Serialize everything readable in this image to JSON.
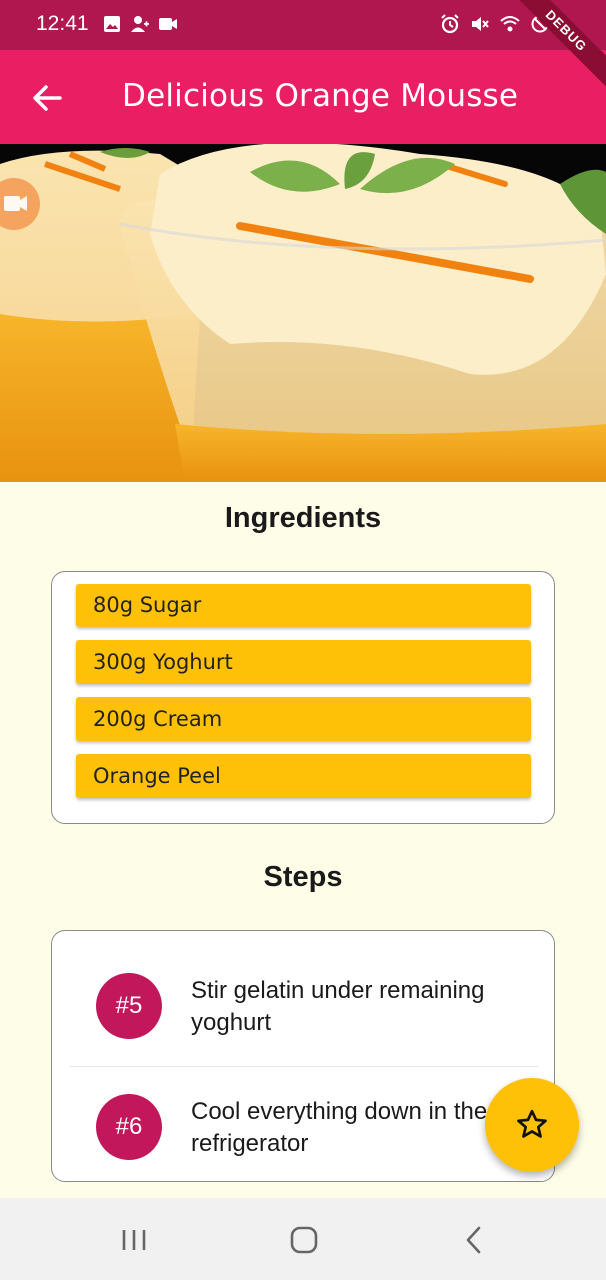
{
  "status_bar": {
    "time": "12:41",
    "left_icons": [
      "image-icon",
      "person-add-icon",
      "video-icon"
    ],
    "right_icons": [
      "alarm-icon",
      "mute-icon",
      "wifi-icon",
      "block-icon",
      "battery-icon"
    ],
    "debug_label": "DEBUG",
    "color": "#b0174f"
  },
  "app_bar": {
    "title": "Delicious Orange Mousse",
    "back_icon": "arrow-back-icon",
    "color": "#e91e63"
  },
  "hero": {
    "video_icon": "videocam-icon"
  },
  "ingredients": {
    "title": "Ingredients",
    "items": [
      "80g Sugar",
      "300g Yoghurt",
      "200g Cream",
      "Orange Peel"
    ],
    "item_color": "#ffc107"
  },
  "steps": {
    "title": "Steps",
    "items": [
      {
        "number": "#5",
        "text": "Stir gelatin under remaining yoghurt"
      },
      {
        "number": "#6",
        "text": "Cool everything down in the refrigerator"
      }
    ],
    "badge_color": "#c2185b"
  },
  "fab": {
    "icon": "star-outline-icon",
    "color": "#ffc107"
  },
  "nav_bar": {
    "icons": [
      "recent-apps-icon",
      "home-icon",
      "back-icon"
    ]
  }
}
